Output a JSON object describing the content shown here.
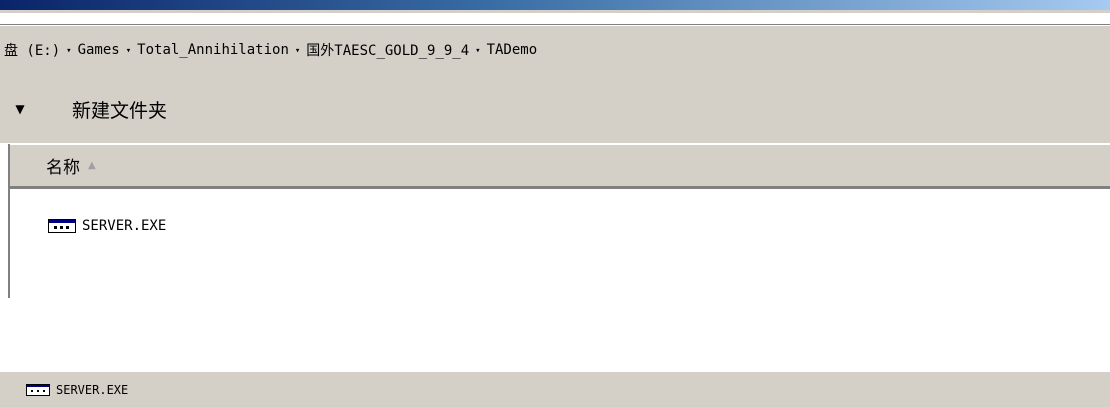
{
  "address": {
    "crumbs": [
      "盘 (E:)",
      "Games",
      "Total_Annihilation",
      "国外TAESC_GOLD_9_9_4",
      "TADemo"
    ],
    "separator": "▾"
  },
  "toolbar": {
    "dropdown_glyph": "▼",
    "new_folder_label": "新建文件夹"
  },
  "file_list": {
    "column_header": "名称",
    "sort_indicator": "▲",
    "items": [
      {
        "name": "SERVER.EXE",
        "icon": "exe-window-icon"
      }
    ]
  },
  "details": {
    "selected_name": "SERVER.EXE",
    "icon": "exe-window-icon"
  },
  "colors": {
    "chrome": "#d4d0c8",
    "title_gradient_start": "#0a246a",
    "title_gradient_end": "#a6caf0"
  }
}
